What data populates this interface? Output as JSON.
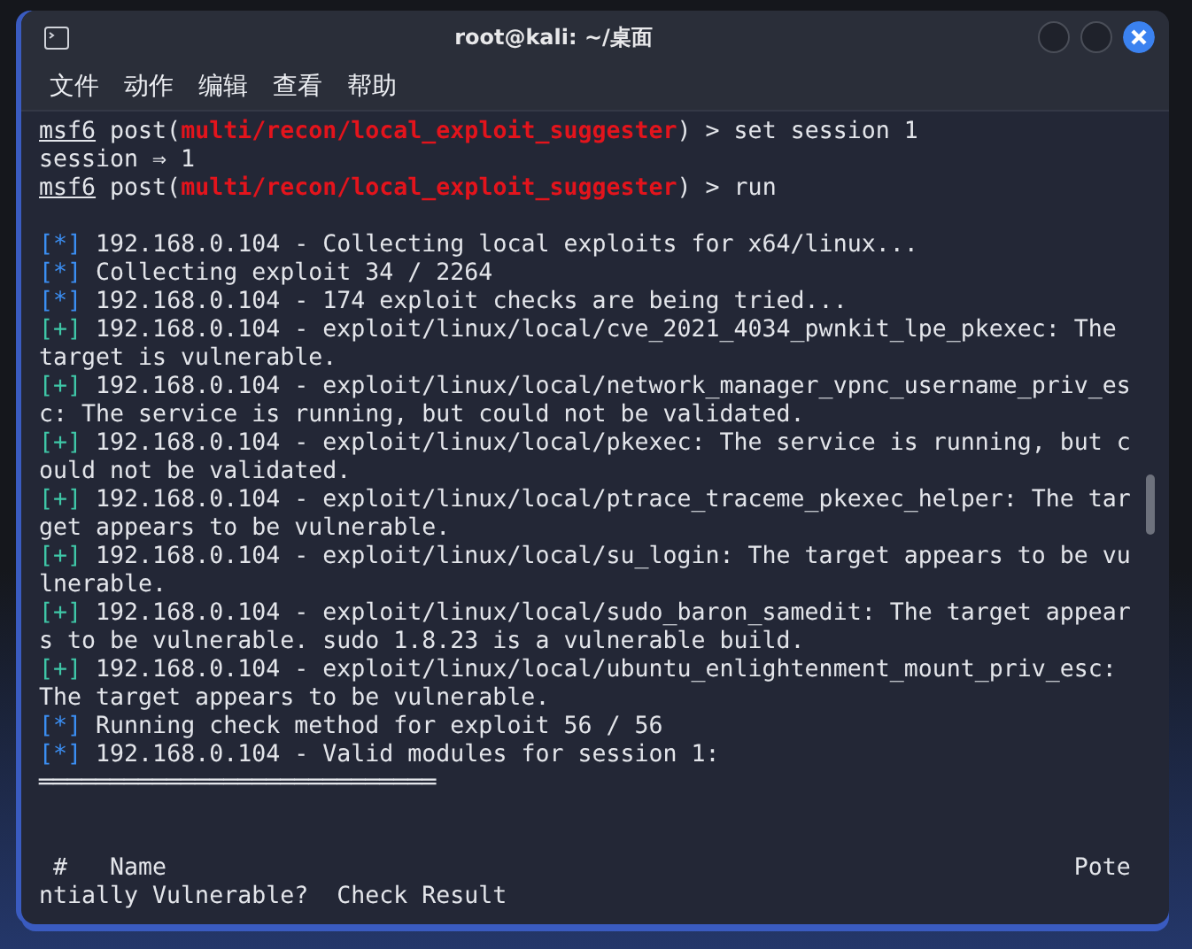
{
  "window": {
    "title": "root@kali: ~/桌面"
  },
  "menu": [
    "文件",
    "动作",
    "编辑",
    "查看",
    "帮助"
  ],
  "terminal": {
    "lines": [
      {
        "kind": "prompt",
        "user": "msf6",
        "before": "post(",
        "module": "multi/recon/local_exploit_suggester",
        "after": ") > set session 1"
      },
      {
        "kind": "plain",
        "text": "session ⇒ 1"
      },
      {
        "kind": "prompt",
        "user": "msf6",
        "before": "post(",
        "module": "multi/recon/local_exploit_suggester",
        "after": ") > run"
      },
      {
        "kind": "blank"
      },
      {
        "kind": "info",
        "marker": "[*]",
        "text": "192.168.0.104 - Collecting local exploits for x64/linux..."
      },
      {
        "kind": "info",
        "marker": "[*]",
        "text": "Collecting exploit 34 / 2264"
      },
      {
        "kind": "info",
        "marker": "[*]",
        "text": "192.168.0.104 - 174 exploit checks are being tried..."
      },
      {
        "kind": "good",
        "marker": "[+]",
        "text": "192.168.0.104 - exploit/linux/local/cve_2021_4034_pwnkit_lpe_pkexec: The target is vulnerable."
      },
      {
        "kind": "good",
        "marker": "[+]",
        "text": "192.168.0.104 - exploit/linux/local/network_manager_vpnc_username_priv_esc: The service is running, but could not be validated."
      },
      {
        "kind": "good",
        "marker": "[+]",
        "text": "192.168.0.104 - exploit/linux/local/pkexec: The service is running, but could not be validated."
      },
      {
        "kind": "good",
        "marker": "[+]",
        "text": "192.168.0.104 - exploit/linux/local/ptrace_traceme_pkexec_helper: The target appears to be vulnerable."
      },
      {
        "kind": "good",
        "marker": "[+]",
        "text": "192.168.0.104 - exploit/linux/local/su_login: The target appears to be vulnerable."
      },
      {
        "kind": "good",
        "marker": "[+]",
        "text": "192.168.0.104 - exploit/linux/local/sudo_baron_samedit: The target appears to be vulnerable. sudo 1.8.23 is a vulnerable build."
      },
      {
        "kind": "good",
        "marker": "[+]",
        "text": "192.168.0.104 - exploit/linux/local/ubuntu_enlightenment_mount_priv_esc: The target appears to be vulnerable."
      },
      {
        "kind": "info",
        "marker": "[*]",
        "text": "Running check method for exploit 56 / 56"
      },
      {
        "kind": "info",
        "marker": "[*]",
        "text": "192.168.0.104 - Valid modules for session 1:"
      },
      {
        "kind": "plain",
        "text": "════════════════════════════"
      },
      {
        "kind": "blank"
      },
      {
        "kind": "blank"
      },
      {
        "kind": "plain",
        "text": " #   Name                                                                Potentially Vulnerable?  Check Result"
      }
    ]
  }
}
